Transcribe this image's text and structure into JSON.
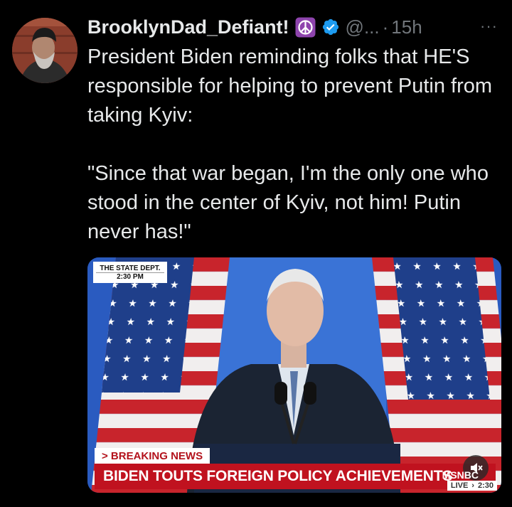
{
  "tweet": {
    "display_name": "BrooklynDad_Defiant!",
    "handle": "@...",
    "separator": "·",
    "time": "15h",
    "more": "···",
    "text_lines": [
      "President Biden reminding folks that HE'S responsible for helping to prevent Putin from taking Kyiv:",
      "\"Since that war began, I'm the only one who stood in the center of Kyiv, not him! Putin never has!\""
    ]
  },
  "media": {
    "bug_line1": "THE STATE DEPT.",
    "bug_line2": "2:30 PM",
    "breaking_tag": "> BREAKING NEWS",
    "chyron": "BIDEN TOUTS FOREIGN POLICY ACHIEVEMENTS",
    "network": "MSNBC",
    "live": "LIVE",
    "live_arrow": "›",
    "live_time": "2:30"
  },
  "colors": {
    "background": "#000000",
    "text": "#e7e9ea",
    "muted": "#71767b",
    "verified": "#1d9bf0",
    "peace_bg": "#8e44ad",
    "chyron_red": "#c0121f"
  },
  "icons": {
    "verified": "verified-badge-icon",
    "peace": "peace-sign-icon",
    "mute": "mute-icon",
    "more": "more-options-icon"
  }
}
